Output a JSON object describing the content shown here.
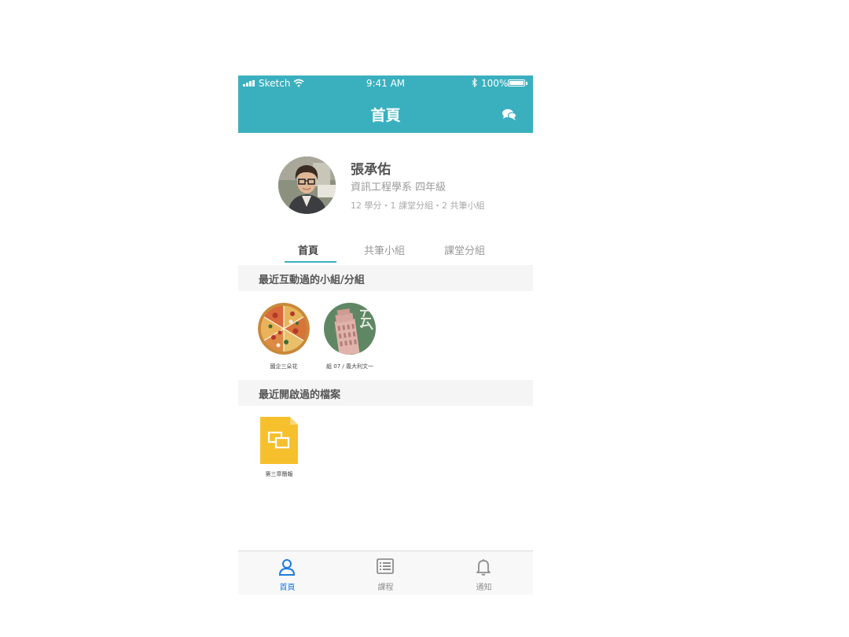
{
  "status_bar": {
    "carrier": "Sketch",
    "time": "9:41 AM",
    "battery": "100%"
  },
  "header": {
    "title": "首頁"
  },
  "profile": {
    "name": "張承佑",
    "department": "資訊工程學系 四年級",
    "stats": "12 學分・1 課堂分組・2 共筆小組"
  },
  "tabs": [
    {
      "label": "首頁"
    },
    {
      "label": "共筆小組"
    },
    {
      "label": "課堂分組"
    }
  ],
  "recent_groups": {
    "title": "最近互動過的小組/分組",
    "items": [
      {
        "label": "國企三朵花"
      },
      {
        "label": "組 07 / 義大利文一"
      }
    ]
  },
  "recent_files": {
    "title": "最近開啟過的檔案",
    "items": [
      {
        "label": "第三章簡報"
      }
    ]
  },
  "tabbar": {
    "items": [
      {
        "label": "首頁",
        "icon": "person-icon"
      },
      {
        "label": "課程",
        "icon": "list-icon"
      },
      {
        "label": "通知",
        "icon": "bell-icon"
      }
    ]
  },
  "colors": {
    "primary": "#3ab0bf",
    "tab_active": "#1d7be0",
    "file_yellow": "#f6c02d"
  }
}
